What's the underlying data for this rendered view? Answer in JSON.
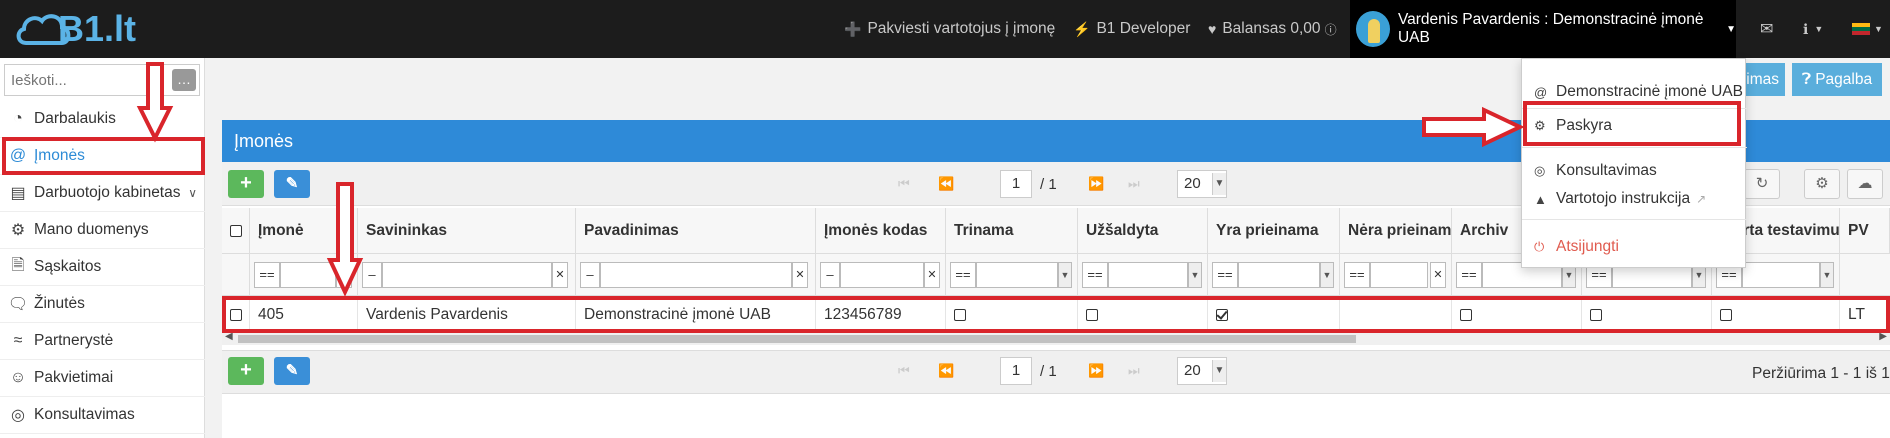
{
  "topbar": {
    "logo_text": "B1.lt",
    "invite": "Pakviesti vartotojus į įmonę",
    "developer": "B1 Developer",
    "balance": "Balansas 0,00",
    "user": "Vardenis Pavardenis : Demonstracinė įmonė UAB"
  },
  "sidebar": {
    "search_placeholder": "Ieškoti...",
    "items": [
      {
        "label": "Darbalaukis",
        "icon": "dashboard-icon"
      },
      {
        "label": "Įmonės",
        "icon": "at-icon"
      },
      {
        "label": "Darbuotojo kabinetas",
        "icon": "id-card-icon"
      },
      {
        "label": "Mano duomenys",
        "icon": "gears-icon"
      },
      {
        "label": "Sąskaitos",
        "icon": "document-icon"
      },
      {
        "label": "Žinutės",
        "icon": "chat-icon"
      },
      {
        "label": "Partnerystė",
        "icon": "handshake-icon"
      },
      {
        "label": "Pakvietimai",
        "icon": "user-plus-icon"
      },
      {
        "label": "Konsultavimas",
        "icon": "lifebuoy-icon"
      }
    ]
  },
  "toolbar": {
    "konsult_partial": "avimas",
    "help": "Pagalba"
  },
  "panel": {
    "title": "Įmonės"
  },
  "pager": {
    "page": "1",
    "total": "/ 1",
    "size": "20",
    "view_count": "Peržiūrima 1 - 1 iš 1"
  },
  "table": {
    "columns": [
      "Įmonė",
      "Savininkas",
      "Pavadinimas",
      "Įmonės kodas",
      "Trinama",
      "Užšaldyta",
      "Yra prieinama",
      "Nėra prieinama",
      "Archiv",
      "",
      "Skirta testavimui",
      "PV"
    ],
    "filter_ops": [
      "==",
      "–",
      "–",
      "–",
      "==",
      "==",
      "==",
      "==",
      "==",
      "==",
      "=="
    ],
    "row": {
      "imone": "405",
      "savininkas": "Vardenis Pavardenis",
      "pavadinimas": "Demonstracinė įmonė UAB",
      "kodas": "123456789",
      "trinama": false,
      "uzsaldyta": false,
      "yra_prieinama": true,
      "archiv": false,
      "col10": false,
      "testavimui": false,
      "pv": "LT"
    }
  },
  "dropdown": {
    "company": "Demonstracinė įmonė UAB",
    "account": "Paskyra",
    "consulting": "Konsultavimas",
    "manual": "Vartotojo instrukcija",
    "logout": "Atsijungti"
  },
  "colors": {
    "accent": "#2e8ad8",
    "annotation": "#d9252b",
    "add": "#5cb85c"
  }
}
